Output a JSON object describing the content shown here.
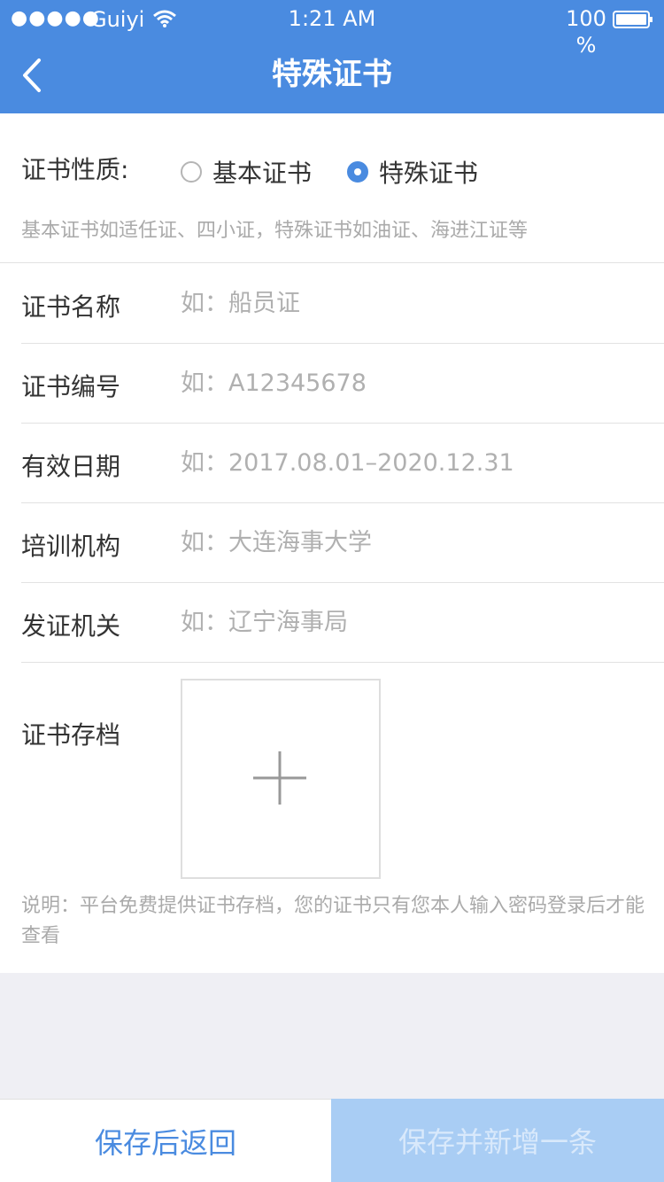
{
  "status_bar": {
    "signal": "●●●●●",
    "carrier": "Guiyi",
    "time": "1:21 AM",
    "battery": "100 %",
    "wifi_icon": "wifi-icon",
    "battery_icon": "battery-icon"
  },
  "header": {
    "title": "特殊证书",
    "back_icon": "chevron-left-icon",
    "background": "#4a8be0"
  },
  "certificate_type": {
    "label": "证书性质:",
    "options": [
      {
        "label": "基本证书",
        "selected": false
      },
      {
        "label": "特殊证书",
        "selected": true
      }
    ],
    "hint": "基本证书如适任证、四小证，特殊证书如油证、海进江证等"
  },
  "fields": [
    {
      "label": "证书名称",
      "value": "",
      "placeholder": "如：船员证"
    },
    {
      "label": "证书编号",
      "value": "",
      "placeholder": "如：A12345678"
    },
    {
      "label": "有效日期",
      "value": "",
      "placeholder": "如：2017.08.01–2020.12.31"
    },
    {
      "label": "培训机构",
      "value": "",
      "placeholder": "如：大连海事大学"
    },
    {
      "label": "发证机关",
      "value": "",
      "placeholder": "如：辽宁海事局"
    }
  ],
  "archive": {
    "label": "证书存档",
    "upload_icon": "plus-icon",
    "note": "说明：平台免费提供证书存档，您的证书只有您本人输入密码登录后才能查看"
  },
  "footer": {
    "save_back": "保存后返回",
    "save_new": "保存并新增一条",
    "accent": "#4a8be0",
    "disabled_bg": "#a9cdf4"
  }
}
